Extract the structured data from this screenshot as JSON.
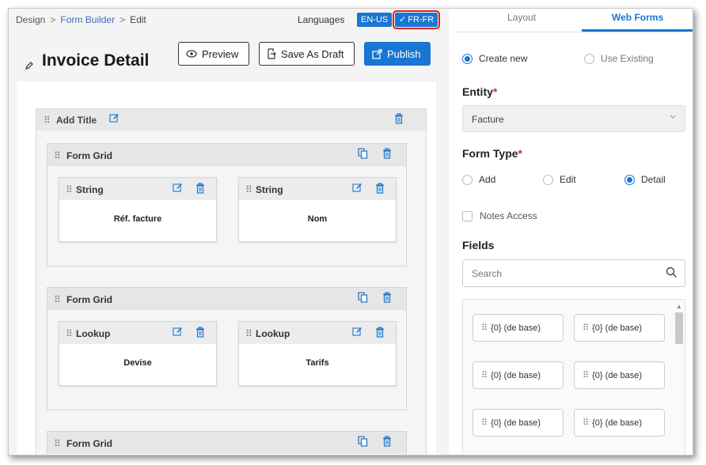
{
  "breadcrumb": {
    "root": "Design",
    "parent": "Form Builder",
    "current": "Edit",
    "separator": ">"
  },
  "languages": {
    "label": "Languages",
    "options": [
      "EN-US",
      "FR-FR"
    ],
    "selected": "FR-FR",
    "check": "✓"
  },
  "page": {
    "title": "Invoice Detail"
  },
  "toolbar": {
    "preview": "Preview",
    "save_draft": "Save As Draft",
    "publish": "Publish"
  },
  "section": {
    "title": "Add Title"
  },
  "grids": [
    {
      "title": "Form Grid",
      "fields": [
        {
          "type": "String",
          "label": "Réf. facture"
        },
        {
          "type": "String",
          "label": "Nom"
        }
      ]
    },
    {
      "title": "Form Grid",
      "fields": [
        {
          "type": "Lookup",
          "label": "Devise"
        },
        {
          "type": "Lookup",
          "label": "Tarifs"
        }
      ]
    },
    {
      "title": "Form Grid",
      "fields": []
    }
  ],
  "tabs": {
    "layout": "Layout",
    "web_forms": "Web Forms",
    "active": "Web Forms"
  },
  "mode": {
    "create_new": "Create new",
    "use_existing": "Use Existing",
    "selected": "Create new"
  },
  "entity": {
    "label": "Entity",
    "required": "*",
    "value": "Facture"
  },
  "form_type": {
    "label": "Form Type",
    "required": "*",
    "options": [
      "Add",
      "Edit",
      "Detail"
    ],
    "selected": "Detail"
  },
  "notes_access": {
    "label": "Notes Access",
    "checked": false
  },
  "fields_panel": {
    "label": "Fields",
    "search_placeholder": "Search",
    "chips": [
      "{0} (de base)",
      "{0} (de base)",
      "{0} (de base)",
      "{0} (de base)",
      "{0} (de base)",
      "{0} (de base)"
    ]
  },
  "colors": {
    "primary": "#1976d2",
    "required": "#d32f2f",
    "highlight_outline": "#e02020"
  }
}
